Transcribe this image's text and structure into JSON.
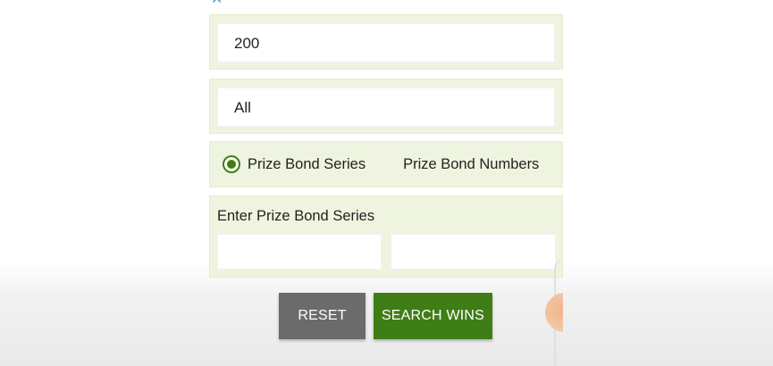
{
  "form": {
    "denomination_value": "200",
    "draw_value": "All",
    "search_mode": {
      "options": [
        {
          "label": "Prize Bond Series",
          "selected": true
        },
        {
          "label": "Prize Bond Numbers",
          "selected": false
        }
      ]
    },
    "series_section": {
      "label": "Enter Prize Bond Series",
      "input_from": "",
      "input_to": ""
    }
  },
  "actions": {
    "reset_label": "RESET",
    "search_label": "SEARCH WINS"
  },
  "colors": {
    "accent_green": "#3f7e16",
    "panel_bg": "#eef4df",
    "reset_gray": "#6b6b6b"
  }
}
